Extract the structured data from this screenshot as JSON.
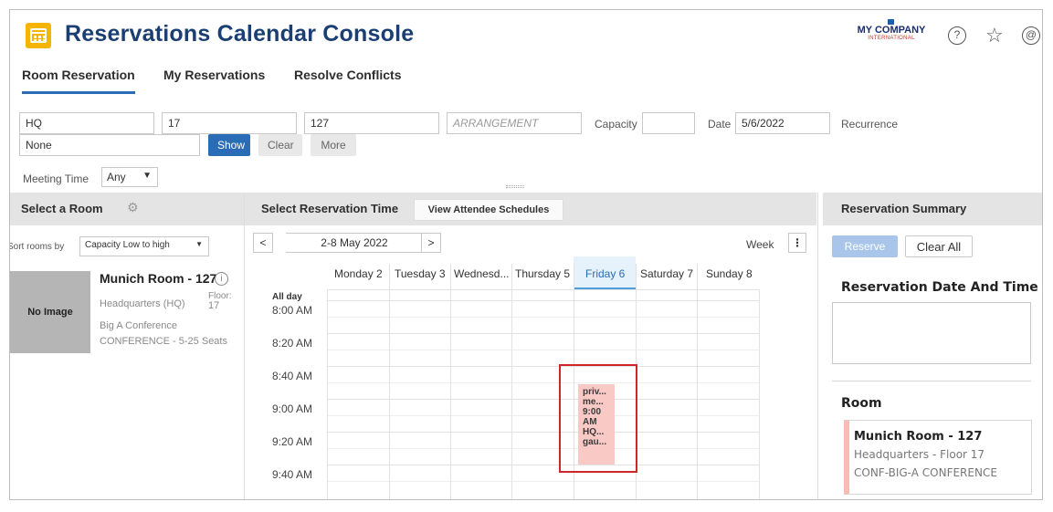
{
  "app": {
    "title": "Reservations Calendar Console"
  },
  "logo": {
    "line1": "MY COMPANY",
    "line2": "INTERNATIONAL"
  },
  "header_icons": {
    "help": "help-circle-icon",
    "favorites": "star-settings-icon",
    "account": "user-circle-icon"
  },
  "tabs": [
    {
      "label": "Room Reservation",
      "active": true
    },
    {
      "label": "My Reservations",
      "active": false
    },
    {
      "label": "Resolve Conflicts",
      "active": false
    }
  ],
  "filters": {
    "site": "HQ",
    "floor": "17",
    "room": "127",
    "arrangement_placeholder": "ARRANGEMENT",
    "capacity_label": "Capacity",
    "capacity_value": "",
    "date_label": "Date",
    "date_value": "5/6/2022",
    "recurrence_label": "Recurrence",
    "recurrence_value": "None",
    "show_label": "Show",
    "clear_label": "Clear",
    "more_label": "More",
    "meeting_time_label": "Meeting Time",
    "meeting_time_value": "Any"
  },
  "left_panel": {
    "title": "Select a Room",
    "sort_label": "Sort rooms by",
    "sort_value": "Capacity  Low to high",
    "room": {
      "image_text": "No Image",
      "name": "Munich Room - 127",
      "location": "Headquarters (HQ)",
      "floor_label": "Floor:",
      "floor": "17",
      "arrangement": "Big A Conference",
      "type_capacity": "CONFERENCE  -  5-25 Seats"
    }
  },
  "calendar": {
    "title": "Select Reservation Time",
    "attendee_button": "View Attendee Schedules",
    "prev": "<",
    "next": ">",
    "range": "2-8 May 2022",
    "view": "Week",
    "more_menu": "⋮",
    "all_day": "All day",
    "days": [
      "Monday 2",
      "Tuesday 3",
      "Wednesd...",
      "Thursday 5",
      "Friday 6",
      "Saturday 7",
      "Sunday 8"
    ],
    "today_index": 4,
    "times": [
      "8:00 AM",
      "8:20 AM",
      "8:40 AM",
      "9:00 AM",
      "9:20 AM",
      "9:40 AM"
    ],
    "event": {
      "lines": [
        "priv...",
        "me...",
        "9:00",
        "AM",
        "HQ...",
        "gau..."
      ]
    }
  },
  "right_panel": {
    "title": "Reservation Summary",
    "reserve_label": "Reserve",
    "clear_all_label": "Clear All",
    "datetime_heading": "Reservation Date And Time",
    "room_heading": "Room",
    "room_name": "Munich Room - 127",
    "room_location": "Headquarters - Floor 17",
    "room_type": "CONF-BIG-A CONFERENCE"
  },
  "colors": {
    "accent": "#2a6cb5",
    "title": "#1b3f73",
    "app_icon": "#f4b400",
    "event": "#f9c9c6",
    "highlight": "#d0262b"
  }
}
